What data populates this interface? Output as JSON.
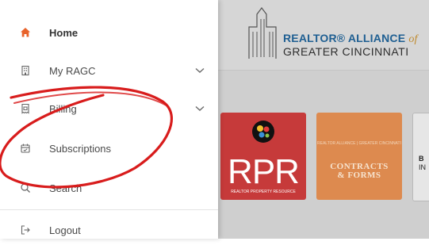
{
  "sidebar": {
    "items": [
      {
        "label": "Home",
        "icon": "home-icon",
        "active": true
      },
      {
        "label": "My RAGC",
        "icon": "building-icon",
        "has_submenu": true
      },
      {
        "label": "Billing",
        "icon": "receipt-icon",
        "has_submenu": true
      },
      {
        "label": "Subscriptions",
        "icon": "calendar-icon"
      },
      {
        "label": "Search",
        "icon": "search-icon"
      },
      {
        "label": "Logout",
        "icon": "logout-icon"
      }
    ]
  },
  "header": {
    "logo_line1": "REALTOR® ALLIANCE",
    "logo_line1_suffix": "of",
    "logo_line2": "GREATER CINCINNATI"
  },
  "tiles": [
    {
      "title": "RPR",
      "subtitle": "REALTOR PROPERTY RESOURCE",
      "color": "#c63a3a"
    },
    {
      "title_line1": "CONTRACTS",
      "title_line2": "& FORMS",
      "small_text": "REALTOR ALLIANCE | GREATER CINCINNATI",
      "color": "#dd8a4f"
    },
    {
      "title_line1": "B",
      "title_line2": "IN"
    }
  ],
  "colors": {
    "accent": "#e8632b",
    "annotation_red": "#d81c1c",
    "logo_blue": "#1f5f92",
    "overlay_gray": "#cfcfcf"
  }
}
